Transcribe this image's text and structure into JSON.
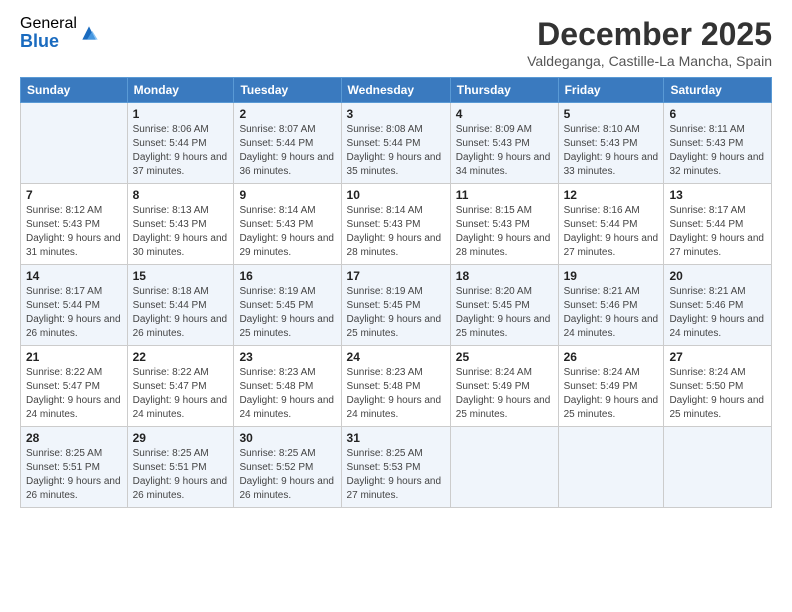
{
  "logo": {
    "general": "General",
    "blue": "Blue"
  },
  "title": "December 2025",
  "subtitle": "Valdeganga, Castille-La Mancha, Spain",
  "days_of_week": [
    "Sunday",
    "Monday",
    "Tuesday",
    "Wednesday",
    "Thursday",
    "Friday",
    "Saturday"
  ],
  "weeks": [
    [
      {
        "day": "",
        "sunrise": "",
        "sunset": "",
        "daylight": ""
      },
      {
        "day": "1",
        "sunrise": "Sunrise: 8:06 AM",
        "sunset": "Sunset: 5:44 PM",
        "daylight": "Daylight: 9 hours and 37 minutes."
      },
      {
        "day": "2",
        "sunrise": "Sunrise: 8:07 AM",
        "sunset": "Sunset: 5:44 PM",
        "daylight": "Daylight: 9 hours and 36 minutes."
      },
      {
        "day": "3",
        "sunrise": "Sunrise: 8:08 AM",
        "sunset": "Sunset: 5:44 PM",
        "daylight": "Daylight: 9 hours and 35 minutes."
      },
      {
        "day": "4",
        "sunrise": "Sunrise: 8:09 AM",
        "sunset": "Sunset: 5:43 PM",
        "daylight": "Daylight: 9 hours and 34 minutes."
      },
      {
        "day": "5",
        "sunrise": "Sunrise: 8:10 AM",
        "sunset": "Sunset: 5:43 PM",
        "daylight": "Daylight: 9 hours and 33 minutes."
      },
      {
        "day": "6",
        "sunrise": "Sunrise: 8:11 AM",
        "sunset": "Sunset: 5:43 PM",
        "daylight": "Daylight: 9 hours and 32 minutes."
      }
    ],
    [
      {
        "day": "7",
        "sunrise": "Sunrise: 8:12 AM",
        "sunset": "Sunset: 5:43 PM",
        "daylight": "Daylight: 9 hours and 31 minutes."
      },
      {
        "day": "8",
        "sunrise": "Sunrise: 8:13 AM",
        "sunset": "Sunset: 5:43 PM",
        "daylight": "Daylight: 9 hours and 30 minutes."
      },
      {
        "day": "9",
        "sunrise": "Sunrise: 8:14 AM",
        "sunset": "Sunset: 5:43 PM",
        "daylight": "Daylight: 9 hours and 29 minutes."
      },
      {
        "day": "10",
        "sunrise": "Sunrise: 8:14 AM",
        "sunset": "Sunset: 5:43 PM",
        "daylight": "Daylight: 9 hours and 28 minutes."
      },
      {
        "day": "11",
        "sunrise": "Sunrise: 8:15 AM",
        "sunset": "Sunset: 5:43 PM",
        "daylight": "Daylight: 9 hours and 28 minutes."
      },
      {
        "day": "12",
        "sunrise": "Sunrise: 8:16 AM",
        "sunset": "Sunset: 5:44 PM",
        "daylight": "Daylight: 9 hours and 27 minutes."
      },
      {
        "day": "13",
        "sunrise": "Sunrise: 8:17 AM",
        "sunset": "Sunset: 5:44 PM",
        "daylight": "Daylight: 9 hours and 27 minutes."
      }
    ],
    [
      {
        "day": "14",
        "sunrise": "Sunrise: 8:17 AM",
        "sunset": "Sunset: 5:44 PM",
        "daylight": "Daylight: 9 hours and 26 minutes."
      },
      {
        "day": "15",
        "sunrise": "Sunrise: 8:18 AM",
        "sunset": "Sunset: 5:44 PM",
        "daylight": "Daylight: 9 hours and 26 minutes."
      },
      {
        "day": "16",
        "sunrise": "Sunrise: 8:19 AM",
        "sunset": "Sunset: 5:45 PM",
        "daylight": "Daylight: 9 hours and 25 minutes."
      },
      {
        "day": "17",
        "sunrise": "Sunrise: 8:19 AM",
        "sunset": "Sunset: 5:45 PM",
        "daylight": "Daylight: 9 hours and 25 minutes."
      },
      {
        "day": "18",
        "sunrise": "Sunrise: 8:20 AM",
        "sunset": "Sunset: 5:45 PM",
        "daylight": "Daylight: 9 hours and 25 minutes."
      },
      {
        "day": "19",
        "sunrise": "Sunrise: 8:21 AM",
        "sunset": "Sunset: 5:46 PM",
        "daylight": "Daylight: 9 hours and 24 minutes."
      },
      {
        "day": "20",
        "sunrise": "Sunrise: 8:21 AM",
        "sunset": "Sunset: 5:46 PM",
        "daylight": "Daylight: 9 hours and 24 minutes."
      }
    ],
    [
      {
        "day": "21",
        "sunrise": "Sunrise: 8:22 AM",
        "sunset": "Sunset: 5:47 PM",
        "daylight": "Daylight: 9 hours and 24 minutes."
      },
      {
        "day": "22",
        "sunrise": "Sunrise: 8:22 AM",
        "sunset": "Sunset: 5:47 PM",
        "daylight": "Daylight: 9 hours and 24 minutes."
      },
      {
        "day": "23",
        "sunrise": "Sunrise: 8:23 AM",
        "sunset": "Sunset: 5:48 PM",
        "daylight": "Daylight: 9 hours and 24 minutes."
      },
      {
        "day": "24",
        "sunrise": "Sunrise: 8:23 AM",
        "sunset": "Sunset: 5:48 PM",
        "daylight": "Daylight: 9 hours and 24 minutes."
      },
      {
        "day": "25",
        "sunrise": "Sunrise: 8:24 AM",
        "sunset": "Sunset: 5:49 PM",
        "daylight": "Daylight: 9 hours and 25 minutes."
      },
      {
        "day": "26",
        "sunrise": "Sunrise: 8:24 AM",
        "sunset": "Sunset: 5:49 PM",
        "daylight": "Daylight: 9 hours and 25 minutes."
      },
      {
        "day": "27",
        "sunrise": "Sunrise: 8:24 AM",
        "sunset": "Sunset: 5:50 PM",
        "daylight": "Daylight: 9 hours and 25 minutes."
      }
    ],
    [
      {
        "day": "28",
        "sunrise": "Sunrise: 8:25 AM",
        "sunset": "Sunset: 5:51 PM",
        "daylight": "Daylight: 9 hours and 26 minutes."
      },
      {
        "day": "29",
        "sunrise": "Sunrise: 8:25 AM",
        "sunset": "Sunset: 5:51 PM",
        "daylight": "Daylight: 9 hours and 26 minutes."
      },
      {
        "day": "30",
        "sunrise": "Sunrise: 8:25 AM",
        "sunset": "Sunset: 5:52 PM",
        "daylight": "Daylight: 9 hours and 26 minutes."
      },
      {
        "day": "31",
        "sunrise": "Sunrise: 8:25 AM",
        "sunset": "Sunset: 5:53 PM",
        "daylight": "Daylight: 9 hours and 27 minutes."
      },
      {
        "day": "",
        "sunrise": "",
        "sunset": "",
        "daylight": ""
      },
      {
        "day": "",
        "sunrise": "",
        "sunset": "",
        "daylight": ""
      },
      {
        "day": "",
        "sunrise": "",
        "sunset": "",
        "daylight": ""
      }
    ]
  ]
}
